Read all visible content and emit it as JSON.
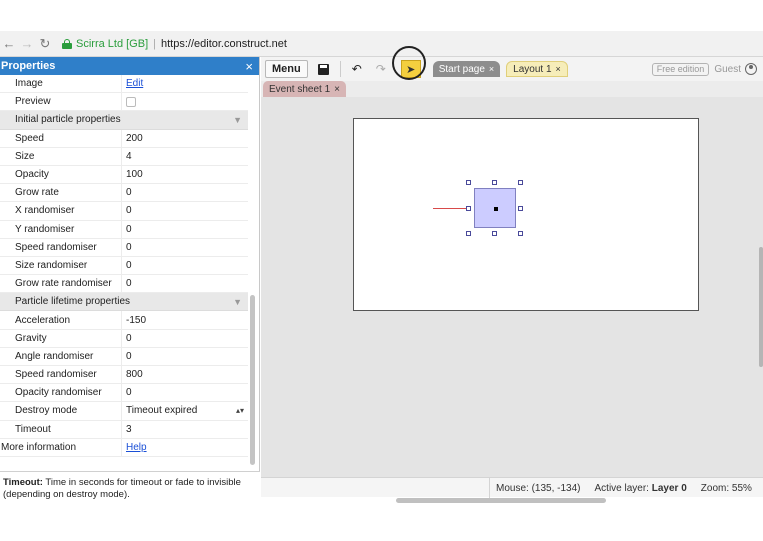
{
  "browser": {
    "site_name": "Scirra Ltd [GB]",
    "url": "https://editor.construct.net"
  },
  "properties_panel": {
    "title": "Properties",
    "close_glyph": "×",
    "top_rows": [
      {
        "name": "Image",
        "value": "Edit"
      },
      {
        "name": "Preview",
        "value": ""
      }
    ],
    "section_initial": "Initial particle properties",
    "initial_rows": [
      {
        "name": "Speed",
        "value": "200"
      },
      {
        "name": "Size",
        "value": "4"
      },
      {
        "name": "Opacity",
        "value": "100"
      },
      {
        "name": "Grow rate",
        "value": "0"
      },
      {
        "name": "X randomiser",
        "value": "0"
      },
      {
        "name": "Y randomiser",
        "value": "0"
      },
      {
        "name": "Speed randomiser",
        "value": "0"
      },
      {
        "name": "Size randomiser",
        "value": "0"
      },
      {
        "name": "Grow rate randomiser",
        "value": "0"
      }
    ],
    "section_lifetime": "Particle lifetime properties",
    "lifetime_rows": [
      {
        "name": "Acceleration",
        "value": "-150"
      },
      {
        "name": "Gravity",
        "value": "0"
      },
      {
        "name": "Angle randomiser",
        "value": "0"
      },
      {
        "name": "Speed randomiser",
        "value": "800"
      },
      {
        "name": "Opacity randomiser",
        "value": "0"
      },
      {
        "name": "Destroy mode",
        "value": "Timeout expired"
      },
      {
        "name": "Timeout",
        "value": "3"
      }
    ],
    "more_info": {
      "name": "More information",
      "value": "Help"
    },
    "description_label": "Timeout:",
    "description_text": "Time in seconds for timeout or fade to invisible (depending on destroy mode)."
  },
  "toolbar": {
    "menu_label": "Menu",
    "tabs": [
      {
        "label": "Start page"
      },
      {
        "label": "Layout 1"
      }
    ],
    "edition": "Free edition",
    "user": "Guest"
  },
  "event_tab": {
    "label": "Event sheet 1"
  },
  "status": {
    "mouse": "Mouse: (135, -134)",
    "active_layer_label": "Active layer:",
    "active_layer_value": "Layer 0",
    "zoom": "Zoom: 55%"
  },
  "colors": {
    "panel_header": "#2f7fc9",
    "sprite_fill": "#ccccff",
    "active_tool": "#f4cf3f",
    "event_tab": "#d7b5b5"
  }
}
